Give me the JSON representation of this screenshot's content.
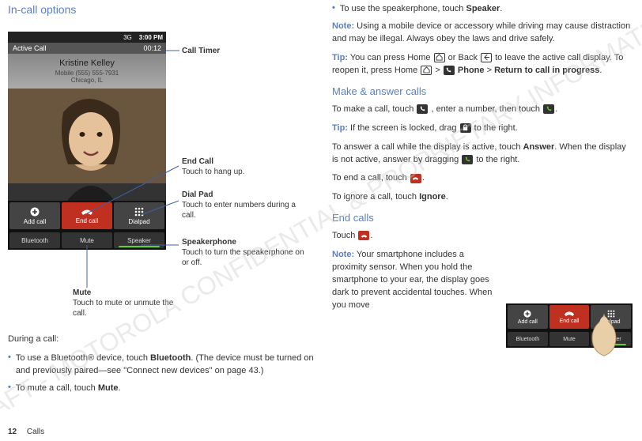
{
  "watermark": "DRAFT - MOTOROLA CONFIDENTIAL & PROPRIETARY INFORMATION",
  "left": {
    "title": "In-call options",
    "phone": {
      "status_time": "3:00 PM",
      "status_3g": "3G",
      "activebar_label": "Active Call",
      "activebar_timer": "00:12",
      "contact_name": "Kristine Kelley",
      "contact_number": "Mobile (555) 555-7931",
      "contact_city": "Chicago, IL",
      "btn_addcall": "Add call",
      "btn_endcall": "End call",
      "btn_dialpad": "Dialpad",
      "btn_bluetooth": "Bluetooth",
      "btn_mute": "Mute",
      "btn_speaker": "Speaker"
    },
    "callouts": {
      "timer_label": "Call Timer",
      "endcall_label": "End Call",
      "endcall_desc": "Touch to hang up.",
      "dialpad_label": "Dial Pad",
      "dialpad_desc": "Touch to enter numbers during a call.",
      "speaker_label": "Speakerphone",
      "speaker_desc": "Touch to turn the speakerphone on or off.",
      "mute_label": "Mute",
      "mute_desc": "Touch to mute or unmute the call."
    },
    "during_label": "During a call:",
    "bullets": {
      "b1a": "To use a Bluetooth® device, touch ",
      "b1b": "Bluetooth",
      "b1c": ". (The device must be turned on and previously paired—see \"Connect new devices\" on page 43.)",
      "b2a": "To mute a call, touch ",
      "b2b": "Mute",
      "b2c": "."
    }
  },
  "right": {
    "bul_sp_a": "To use the speakerphone, touch ",
    "bul_sp_b": "Speaker",
    "bul_sp_c": ".",
    "note_label": "Note:",
    "note_body": " Using a mobile device or accessory while driving may cause distraction and may be illegal. Always obey the laws and drive safely.",
    "tip_label": "Tip:",
    "tip1a": " You can press Home ",
    "tip1b": " or Back ",
    "tip1c": " to leave the active call display. To reopen it, press Home ",
    "tip1d": " > ",
    "tip1_phone": "Phone",
    "tip1e": " > ",
    "tip1_return": "Return to call in progress",
    "tip1f": ".",
    "make_title": "Make & answer calls",
    "make_a": "To make a call, touch ",
    "make_b": ", enter a number, then touch ",
    "make_c": ".",
    "tip2a": " If the screen is locked, drag ",
    "tip2b": " to the right.",
    "ans_a": "To answer a call while the display is active, touch ",
    "ans_answer": "Answer",
    "ans_b": ". When the display is not active, answer by dragging ",
    "ans_c": " to the right.",
    "end_a": "To end a call, touch ",
    "end_b": ".",
    "ign_a": "To ignore a call, touch ",
    "ign_b": "Ignore",
    "ign_c": ".",
    "endcalls_title": "End calls",
    "endcalls_touch": "Touch ",
    "endcalls_dot": ".",
    "note2_a": " Your smartphone includes a proximity sensor. When you hold the smartphone to your ear, the display goes dark to prevent accidental touches. When you move"
  },
  "mini": {
    "addcall": "Add call",
    "endcall": "End call",
    "dialpad": "Dialpad",
    "bluetooth": "Bluetooth",
    "mute": "Mute",
    "speaker": "Speaker"
  },
  "footer": {
    "page": "12",
    "section": "Calls"
  }
}
